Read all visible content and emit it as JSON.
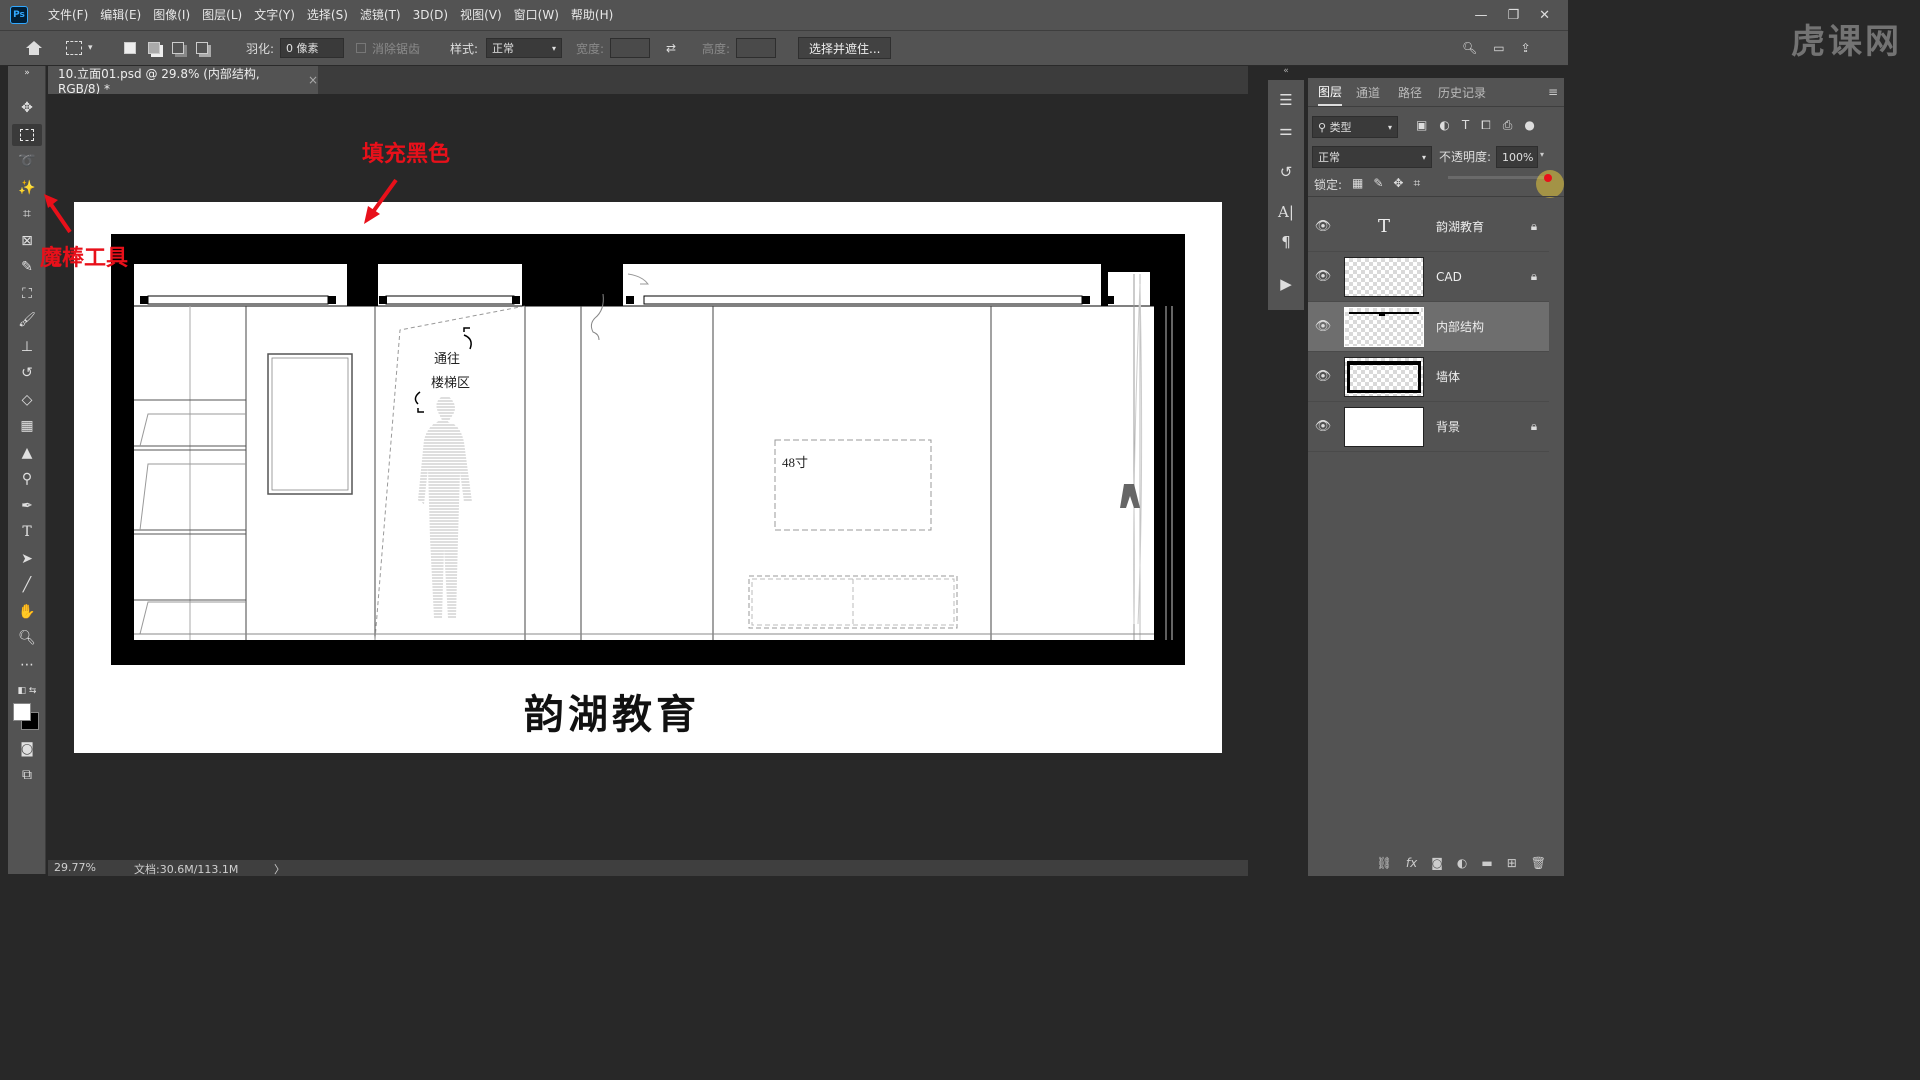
{
  "app": {
    "logo": "Ps"
  },
  "menu": [
    "文件(F)",
    "编辑(E)",
    "图像(I)",
    "图层(L)",
    "文字(Y)",
    "选择(S)",
    "滤镜(T)",
    "3D(D)",
    "视图(V)",
    "窗口(W)",
    "帮助(H)"
  ],
  "watermark": "虎课网",
  "options": {
    "feather_label": "羽化:",
    "feather_value": "0 像素",
    "antialias_label": "消除锯齿",
    "style_label": "样式:",
    "style_value": "正常",
    "width_label": "宽度:",
    "height_label": "高度:",
    "select_mask_button": "选择并遮住..."
  },
  "document": {
    "tab_title": "10.立面01.psd @ 29.8% (内部结构, RGB/8) *",
    "zoom": "29.77%",
    "doc_info": "文档:30.6M/113.1M",
    "drawing_texts": {
      "stair_line1": "通往",
      "stair_line2": "楼梯区",
      "tv_label": "48寸",
      "title": "韵湖教育"
    }
  },
  "annotations": {
    "fill_black": "填充黑色",
    "magic_wand": "魔棒工具",
    "color": "#e8101a"
  },
  "layers_panel": {
    "tabs": [
      "图层",
      "通道",
      "路径",
      "历史记录"
    ],
    "active_tab": "图层",
    "filter_label": "类型",
    "blend_mode": "正常",
    "opacity_label": "不透明度:",
    "opacity_value": "100%",
    "lock_label": "锁定:",
    "layers": [
      {
        "name": "韵湖教育",
        "type": "text",
        "locked": true,
        "selected": false
      },
      {
        "name": "CAD",
        "type": "pixel",
        "locked": true,
        "selected": false
      },
      {
        "name": "内部结构",
        "type": "pixel",
        "locked": false,
        "selected": true
      },
      {
        "name": "墙体",
        "type": "pixel",
        "locked": false,
        "selected": false
      },
      {
        "name": "背景",
        "type": "background",
        "locked": true,
        "selected": false
      }
    ]
  }
}
